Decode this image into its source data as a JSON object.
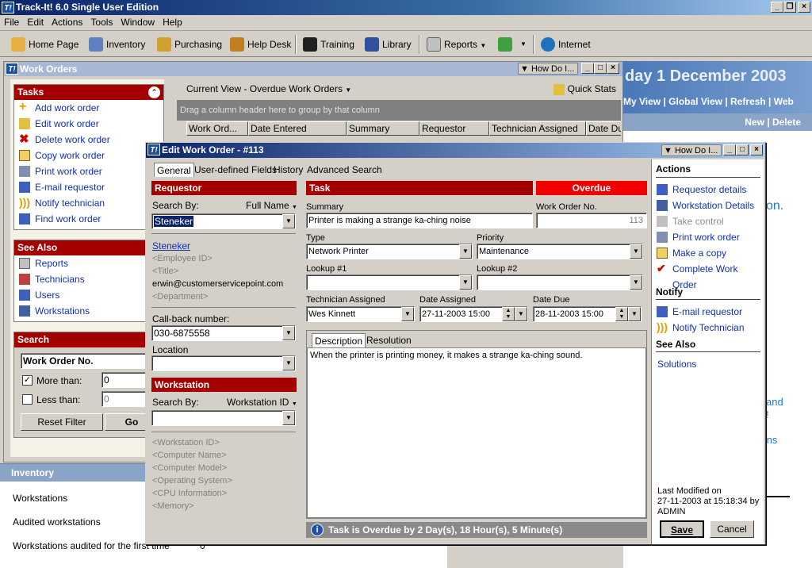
{
  "app": {
    "title": "Track-It! 6.0 Single User Edition",
    "logo": "T!"
  },
  "menu": [
    "File",
    "Edit",
    "Actions",
    "Tools",
    "Window",
    "Help"
  ],
  "toolbar": {
    "home": "Home Page",
    "inventory": "Inventory",
    "purchasing": "Purchasing",
    "helpdesk": "Help Desk",
    "training": "Training",
    "library": "Library",
    "reports": "Reports",
    "internet": "Internet"
  },
  "wo": {
    "title": "Work Orders",
    "howdo": "How Do I...",
    "current_view": "Current View - Overdue Work Orders",
    "quick_stats": "Quick Stats",
    "drag_hint": "Drag a column header here to group by that column",
    "columns": [
      "Work Ord...",
      "Date Entered",
      "Summary",
      "Requestor",
      "Technician Assigned",
      "Date Du"
    ]
  },
  "tasks": {
    "title": "Tasks",
    "items": [
      "Add work order",
      "Edit work order",
      "Delete work order",
      "Copy work order",
      "Print work order",
      "E-mail requestor",
      "Notify technician",
      "Find work order"
    ]
  },
  "seealso": {
    "title": "See Also",
    "items": [
      "Reports",
      "Technicians",
      "Users",
      "Workstations"
    ]
  },
  "search": {
    "title": "Search",
    "field": "Work Order No.",
    "more": "More than:",
    "less": "Less than:",
    "more_val": "0",
    "less_val": "0",
    "reset": "Reset Filter",
    "go": "Go"
  },
  "inventory": {
    "title": "Inventory",
    "items": [
      "Workstations",
      "Audited workstations",
      "Workstations audited for the first time"
    ],
    "count": "0"
  },
  "bg": {
    "date": "day 1 December 2003",
    "links": [
      "My View",
      "Global View",
      "Refresh",
      "Web"
    ],
    "newdel": [
      "New",
      "Delete"
    ],
    "frag1": "on.",
    "frag2": "and",
    "frag3": "!",
    "frag4": "cians"
  },
  "edit": {
    "title": "Edit Work Order - #113",
    "howdo": "How Do I...",
    "tabs": [
      "General",
      "User-defined Fields",
      "History",
      "Advanced Search"
    ],
    "requestor": {
      "header": "Requestor",
      "search_by": "Search By:",
      "search_mode": "Full Name",
      "value": "Steneker",
      "name": "Steneker",
      "employee_id": "<Employee ID>",
      "title": "<Title>",
      "email": "erwin@customerservicepoint.com",
      "department": "<Department>",
      "callback_label": "Call-back number:",
      "callback": "030-6875558",
      "location_label": "Location",
      "location": ""
    },
    "workstation": {
      "header": "Workstation",
      "search_by": "Search By:",
      "search_mode": "Workstation ID",
      "value": "",
      "fields": [
        "<Workstation ID>",
        "<Computer Name>",
        "<Computer Model>",
        "<Operating System>",
        "<CPU Information>",
        "<Memory>"
      ]
    },
    "task": {
      "header": "Task",
      "status": "Overdue",
      "summary_label": "Summary",
      "summary": "Printer is making a strange ka-ching noise",
      "wo_no_label": "Work Order No.",
      "wo_no": "113",
      "type_label": "Type",
      "type": "Network Printer",
      "priority_label": "Priority",
      "priority": "Maintenance",
      "lookup1_label": "Lookup #1",
      "lookup1": "",
      "lookup2_label": "Lookup #2",
      "lookup2": "",
      "tech_label": "Technician Assigned",
      "tech": "Wes Kinnett",
      "assigned_label": "Date Assigned",
      "assigned": "27-11-2003 15:00",
      "due_label": "Date Due",
      "due": "28-11-2003 15:00",
      "desc_tab": "Description",
      "res_tab": "Resolution",
      "description": "When the printer is printing money, it makes a strange ka-ching sound.",
      "overdue_msg": "Task is Overdue by 2 Day(s), 18 Hour(s), 5 Minute(s)"
    },
    "actions": {
      "header": "Actions",
      "items": [
        "Requestor details",
        "Workstation Details",
        "Take control",
        "Print work order",
        "Make a copy",
        "Complete Work Order"
      ],
      "notify_header": "Notify",
      "notify": [
        "E-mail requestor",
        "Notify Technician"
      ],
      "seealso_header": "See Also",
      "seealso": [
        "Solutions"
      ]
    },
    "modified": {
      "line1": "Last Modified on",
      "line2": "27-11-2003 at 15:18:34 by",
      "line3": "ADMIN"
    },
    "save": "Save",
    "cancel": "Cancel"
  }
}
